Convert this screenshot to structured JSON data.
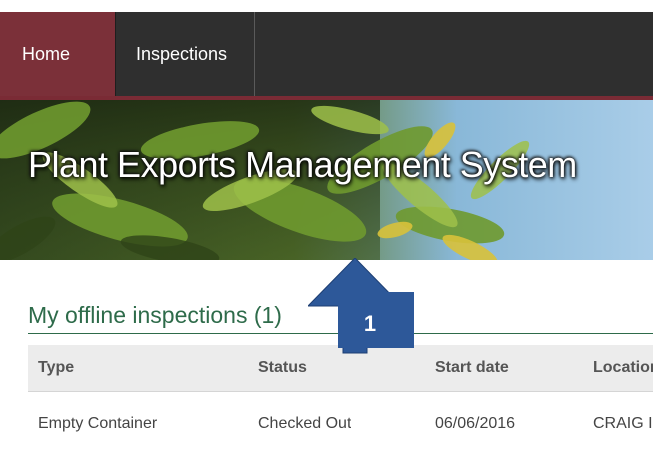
{
  "nav": {
    "items": [
      {
        "label": "Home",
        "active": true
      },
      {
        "label": "Inspections",
        "active": false
      }
    ]
  },
  "banner": {
    "title": "Plant Exports Management System"
  },
  "offline": {
    "heading": "My offline inspections (1)",
    "columns": [
      "Type",
      "Status",
      "Start date",
      "Location"
    ],
    "rows": [
      {
        "type": "Empty Container",
        "status": "Checked Out",
        "start_date": "06/06/2016",
        "location": "CRAIG I"
      }
    ]
  },
  "callout": {
    "number": "1",
    "color": "#2d5899"
  },
  "colors": {
    "navbar": "#2f2f2f",
    "nav_active": "#7b3039",
    "accent_rule": "#7a2b35",
    "heading_green": "#2e6b4a"
  }
}
